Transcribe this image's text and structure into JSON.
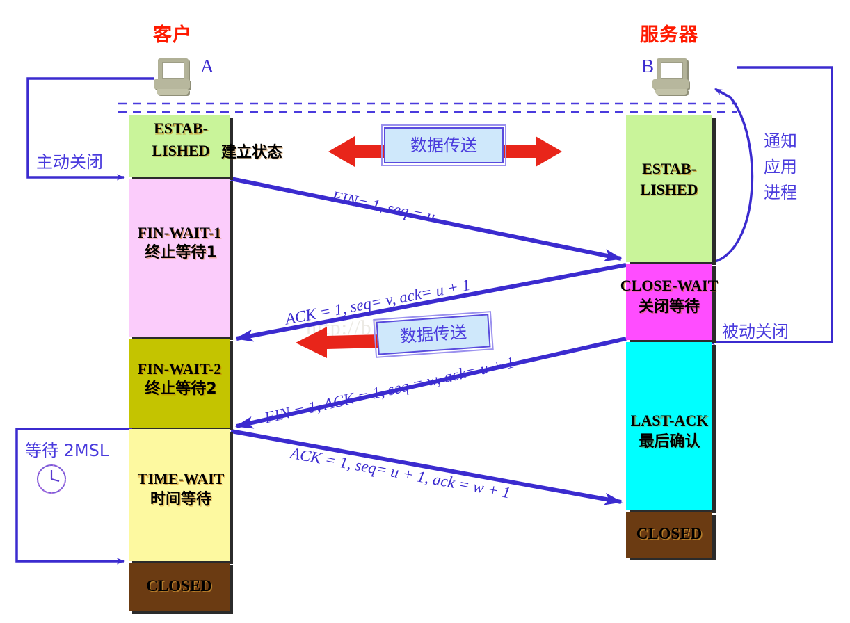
{
  "diagram": {
    "title_client": "客户",
    "title_server": "服务器",
    "label_client_letter": "A",
    "label_server_letter": "B",
    "watermark": "http://blog.csdn.net/"
  },
  "colors": {
    "established": "#c9f49a",
    "fin_wait_1": "#fbccfb",
    "fin_wait_2": "#c4c400",
    "time_wait": "#fdf9a0",
    "closed": "#6b3b12",
    "close_wait": "#ff4dff",
    "last_ack": "#00ffff",
    "arrow_blue": "#3b2bcf",
    "note_blue": "#4a3bdd",
    "title_red": "#ff1a00",
    "data_arrow_red": "#e8251a",
    "badge_fill": "#cfe8fb"
  },
  "client": {
    "states": [
      {
        "en": "ESTAB-\nLISHED",
        "cn": "",
        "color_key": "established"
      },
      {
        "en": "FIN-WAIT-1",
        "cn": "终止等待1",
        "color_key": "fin_wait_1"
      },
      {
        "en": "FIN-WAIT-2",
        "cn": "终止等待2",
        "color_key": "fin_wait_2"
      },
      {
        "en": "TIME-WAIT",
        "cn": "时间等待",
        "color_key": "time_wait"
      },
      {
        "en": "CLOSED",
        "cn": "",
        "color_key": "closed"
      }
    ],
    "established_line1": "ESTAB-",
    "established_line2": "LISHED",
    "established_cn": "建立状态",
    "fin_wait_1_en": "FIN-WAIT-1",
    "fin_wait_1_cn": "终止等待1",
    "fin_wait_2_en": "FIN-WAIT-2",
    "fin_wait_2_cn": "终止等待2",
    "time_wait_en": "TIME-WAIT",
    "time_wait_cn": "时间等待",
    "closed_en": "CLOSED",
    "active_close_note": "主动关闭",
    "wait_2msl_note": "等待 2MSL"
  },
  "server": {
    "established_line1": "ESTAB-",
    "established_line2": "LISHED",
    "close_wait_en": "CLOSE-WAIT",
    "close_wait_cn": "关闭等待",
    "last_ack_en": "LAST-ACK",
    "last_ack_cn": "最后确认",
    "closed_en": "CLOSED",
    "notify_app_note": "通知\n应用\n进程",
    "notify_app_line1": "通知",
    "notify_app_line2": "应用",
    "notify_app_line3": "进程",
    "passive_close_note": "被动关闭"
  },
  "messages": [
    {
      "id": "fin1",
      "text": "FIN= 1, seq = u",
      "direction": "client-to-server"
    },
    {
      "id": "ack1",
      "text": "ACK = 1, seq= v, ack= u + 1",
      "direction": "server-to-client"
    },
    {
      "id": "fin2",
      "text": "FIN = 1, ACK = 1, seq = w, ack= u + 1",
      "direction": "server-to-client"
    },
    {
      "id": "ack2",
      "text": "ACK = 1, seq= u + 1, ack = w + 1",
      "direction": "client-to-server"
    }
  ],
  "data_badges": [
    {
      "id": "top",
      "text": "数据传送",
      "arrows": "both"
    },
    {
      "id": "bottom",
      "text": "数据传送",
      "arrows": "left"
    }
  ]
}
